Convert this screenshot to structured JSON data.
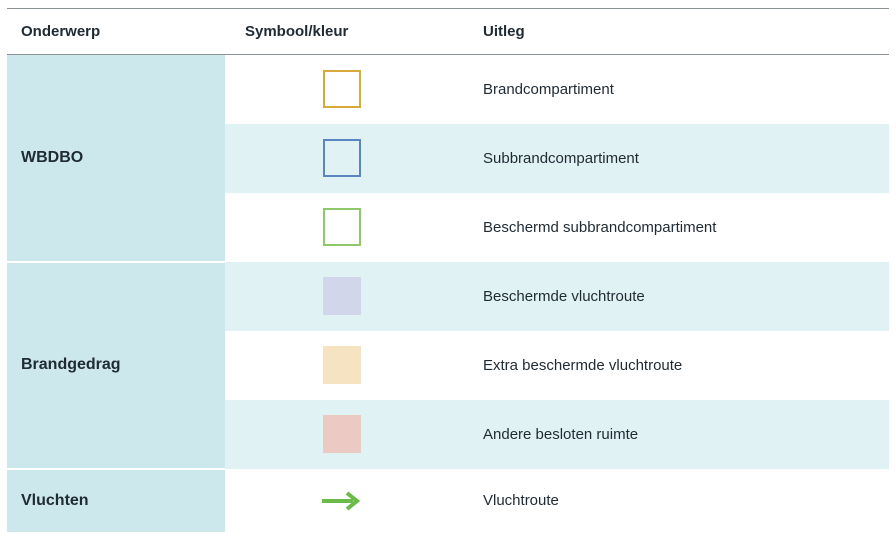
{
  "header": {
    "topic": "Onderwerp",
    "symbol": "Symbool/kleur",
    "description": "Uitleg"
  },
  "groups": {
    "wbdbo": "WBDBO",
    "brandgedrag": "Brandgedrag",
    "vluchten": "Vluchten"
  },
  "rows": [
    {
      "symbol_type": "outline",
      "color": "#d9a93c",
      "label": "Brandcompartiment"
    },
    {
      "symbol_type": "outline",
      "color": "#5b86c4",
      "label": "Subbrandcompartiment"
    },
    {
      "symbol_type": "outline",
      "color": "#8fc86b",
      "label": "Beschermd subbrandcompartiment"
    },
    {
      "symbol_type": "fill",
      "color": "#d2d6ea",
      "label": "Beschermde vluchtroute"
    },
    {
      "symbol_type": "fill",
      "color": "#f5e3c2",
      "label": "Extra beschermde vluchtroute"
    },
    {
      "symbol_type": "fill",
      "color": "#eccac4",
      "label": "Andere besloten ruimte"
    },
    {
      "symbol_type": "arrow",
      "color": "#6cba4a",
      "icon": "arrow-right-icon",
      "label": "Vluchtroute"
    }
  ]
}
